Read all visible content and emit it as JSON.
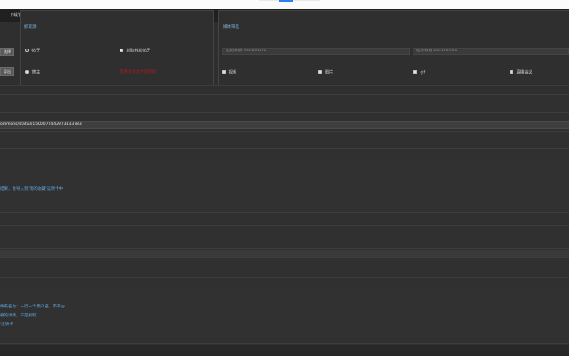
{
  "tabs": [
    "下载管理",
    "设置"
  ],
  "buttons": {
    "left_top": "选择",
    "left_bottom": "导出"
  },
  "section_titles": {
    "left": "抓取源",
    "right": "媒体筛选"
  },
  "left_options": {
    "radio_1": "帖子",
    "radio_2": "博主",
    "checkbox": "抓取转发帖子",
    "warning": "需要登录后才能获取"
  },
  "date_fields": {
    "start": "起始日期 2021/01/01",
    "end": "结束日期 2021/02/01"
  },
  "right_options": {
    "item_1": "视频",
    "item_2": "图片",
    "item_3": "gif",
    "item_4": "直播会议"
  },
  "url_value": "ommons/status/1500072442973433783",
  "info_lines": {
    "line_1": "结果，会导入到'我的收藏'选项卡中",
    "line_2": "件夹名为：一行一个用户名，不带@",
    "line_3": "载的详情，不是抓取",
    "line_4": "'选项卡"
  },
  "colors": {
    "background": "#303030",
    "accent": "#63a9e0",
    "warning": "#a61d1d"
  }
}
